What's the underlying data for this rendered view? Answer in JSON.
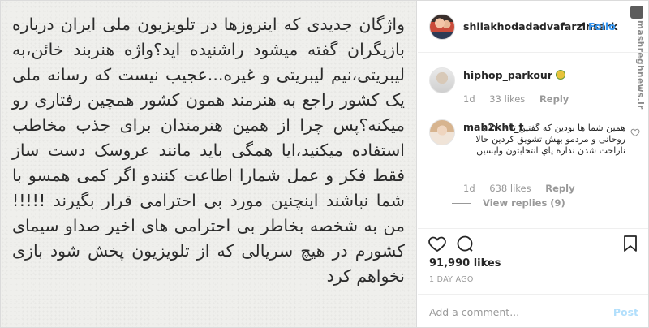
{
  "post": {
    "text": "واژگان جدیدی که اینروزها در تلویزیون ملی ایران درباره بازیگران گفته میشود راشنیده اید؟واژه هنربند خائن،به لیبریتی،نیم لیبریتی و غیره...عجیب نیست که رسانه ملی یک کشور راجع به هنرمند همون کشور همچین رفتاری رو میکنه؟پس چرا از همین هنرمندان برای جذب مخاطب استفاده میکنید،ایا همگی باید مانند عروسک دست ساز فقط فکر و عمل شمارا اطاعت کنندو اگر کمی همسو با شما نباشند اینچنین مورد بی احترامی قرار بگیرند !!!!!من به شخصه بخاطر بی احترامی های اخیر صداو سیمای کشورم در هیچ سریالی که از تلویزیون پخش شود بازی نخواهم کرد"
  },
  "header": {
    "username": "shilakhodadadvafarzinsark",
    "dot": "•",
    "follow_label": "Follo"
  },
  "watermark": {
    "text": "mashreghnews.ir"
  },
  "comments": [
    {
      "username": "hiphop_parkour",
      "emoji": "sunflower-emoji",
      "text": "",
      "time": "1d",
      "likes": "33 likes",
      "reply": "Reply"
    },
    {
      "username": "mah2kht_t",
      "text": "همین شما ها بودین که گفتین تا ۱۴۰۰ با روحانی و مردمو بهش تشویق کردین حالا ناراحت شدن نداره پاي انتخابتون وايسين",
      "time": "1d",
      "likes": "638 likes",
      "reply": "Reply"
    }
  ],
  "view_replies": "View replies (9)",
  "actions": {
    "likes": "91,990 likes",
    "date": "1 DAY AGO"
  },
  "add_comment": {
    "placeholder": "Add a comment...",
    "post_label": "Post"
  },
  "colors": {
    "link_blue": "#3897f0",
    "post_disabled": "#b2dffc",
    "meta_gray": "#999999"
  }
}
